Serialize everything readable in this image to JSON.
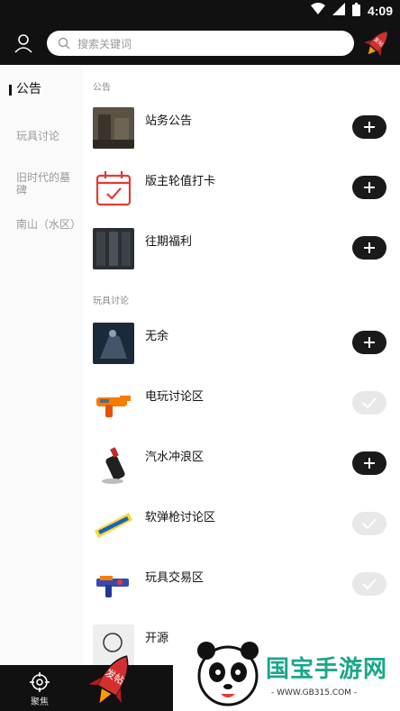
{
  "status_bar": {
    "time": "4:09"
  },
  "search": {
    "placeholder": "搜索关键词"
  },
  "post_badge": "发帖",
  "left_nav": {
    "items": [
      {
        "label": "公告"
      },
      {
        "label": "玩具讨论"
      },
      {
        "label": "旧时代的墓碑"
      },
      {
        "label": "南山（水区）"
      }
    ]
  },
  "sections": [
    {
      "label": "公告",
      "rows": [
        {
          "name": "站务公告",
          "action": "add"
        },
        {
          "name": "版主轮值打卡",
          "action": "add"
        },
        {
          "name": "往期福利",
          "action": "add"
        }
      ]
    },
    {
      "label": "玩具讨论",
      "rows": [
        {
          "name": "无余",
          "action": "add"
        },
        {
          "name": "电玩讨论区",
          "action": "done"
        },
        {
          "name": "汽水冲浪区",
          "action": "add"
        },
        {
          "name": "软弹枪讨论区",
          "action": "done"
        },
        {
          "name": "玩具交易区",
          "action": "done"
        },
        {
          "name": "开源",
          "action": "add"
        }
      ]
    }
  ],
  "bottom_nav": {
    "focus_label": "聚焦",
    "post_label": "发帖"
  },
  "watermark": {
    "title": "国宝手游网",
    "url": "- WWW.GB315.COM -"
  },
  "colors": {
    "dark": "#111111",
    "accent_red": "#d32f2f",
    "watermark_green": "#1aa78a"
  }
}
